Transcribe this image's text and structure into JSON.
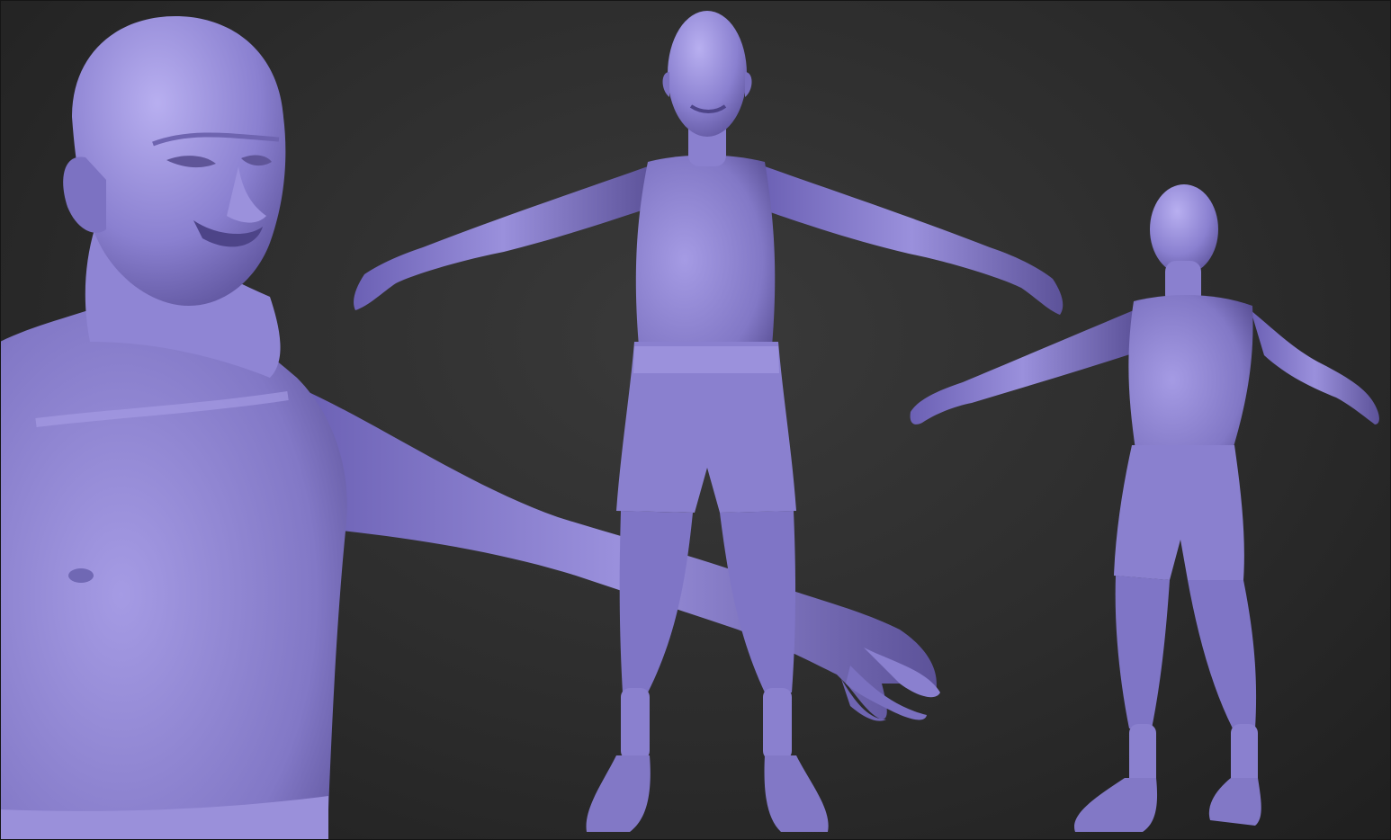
{
  "scene": {
    "background_color": "#2e2e2e",
    "material_color": "#8478c8",
    "material_highlight": "#b3a8ea",
    "material_shadow": "#4c4288",
    "views": [
      "closeup-three-quarter",
      "front",
      "back-three-quarter"
    ]
  }
}
